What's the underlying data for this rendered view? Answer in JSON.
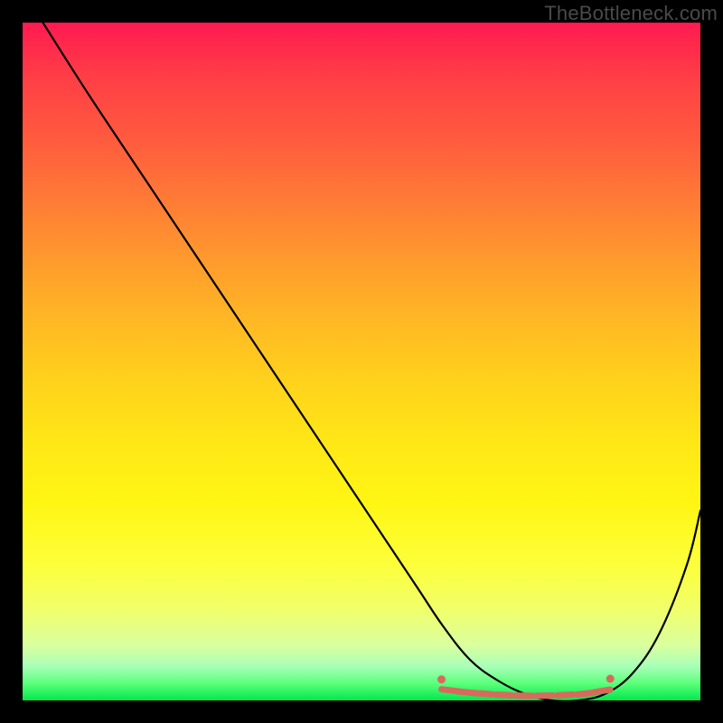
{
  "watermark": "TheBottleneck.com",
  "chart_data": {
    "type": "line",
    "title": "",
    "xlabel": "",
    "ylabel": "",
    "xlim": [
      0,
      100
    ],
    "ylim": [
      0,
      100
    ],
    "grid": false,
    "gradient_bands": [
      {
        "color": "#ff1a51",
        "position_pct": 0
      },
      {
        "color": "#ffe716",
        "position_pct": 62
      },
      {
        "color": "#00e84a",
        "position_pct": 100
      }
    ],
    "series": [
      {
        "name": "bottleneck-curve",
        "color": "#000000",
        "x": [
          3,
          10,
          20,
          30,
          40,
          50,
          58,
          62,
          66,
          70,
          74,
          78,
          82,
          86,
          90,
          94,
          98,
          100
        ],
        "y": [
          100,
          89,
          74,
          59,
          44,
          29,
          17,
          11,
          6,
          3,
          1,
          0,
          0,
          1,
          4,
          10,
          20,
          28
        ]
      },
      {
        "name": "optimal-markers",
        "color": "#d86a5d",
        "style": "dashed-segments",
        "x": [
          63,
          65.5,
          68,
          71,
          74,
          77,
          80,
          83,
          85.5
        ],
        "y": [
          1.5,
          1.2,
          1.0,
          0.8,
          0.7,
          0.7,
          0.8,
          1.0,
          1.4
        ]
      }
    ],
    "optimal_range_x": [
      63,
      86
    ]
  }
}
